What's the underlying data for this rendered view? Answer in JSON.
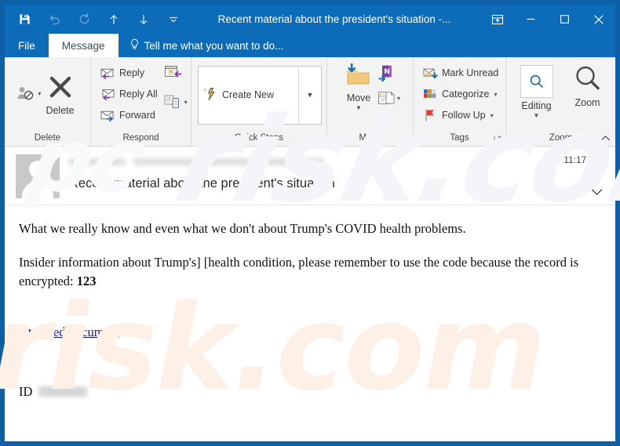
{
  "window": {
    "title": "Recent material about the president's situation -...",
    "accent_color": "#0d6cb9",
    "frame_border_color": "#0f5fa6"
  },
  "quick_access_toolbar": {
    "items": [
      {
        "name": "save-icon",
        "label": "Save",
        "enabled": true
      },
      {
        "name": "undo-icon",
        "label": "Undo",
        "enabled": false
      },
      {
        "name": "redo-icon",
        "label": "Redo",
        "enabled": false
      },
      {
        "name": "previous-item-icon",
        "label": "Previous Item",
        "enabled": true
      },
      {
        "name": "next-item-icon",
        "label": "Next Item",
        "enabled": true
      },
      {
        "name": "customize-qat-icon",
        "label": "Customize Quick Access Toolbar",
        "enabled": true
      }
    ]
  },
  "window_controls": [
    {
      "name": "ribbon-display-options-icon",
      "label": "Ribbon Display Options"
    },
    {
      "name": "minimize-icon",
      "label": "Minimize"
    },
    {
      "name": "maximize-icon",
      "label": "Maximize"
    },
    {
      "name": "close-icon",
      "label": "Close"
    }
  ],
  "tabs": [
    {
      "label": "File",
      "active": false
    },
    {
      "label": "Message",
      "active": true
    }
  ],
  "tell_me": {
    "label": "Tell me what you want to do...",
    "icon": "lightbulb-icon"
  },
  "ribbon": {
    "collapse_label": "^",
    "groups": [
      {
        "name": "delete",
        "label": "Delete",
        "buttons": [
          {
            "label": "Junk",
            "icon": "junk-icon",
            "type": "icon-only-dropdown"
          },
          {
            "label": "Delete",
            "icon": "delete-x-icon",
            "type": "big"
          }
        ]
      },
      {
        "name": "respond",
        "label": "Respond",
        "buttons": [
          {
            "label": "Reply",
            "icon": "reply-icon",
            "type": "small"
          },
          {
            "label": "Reply All",
            "icon": "reply-all-icon",
            "type": "small"
          },
          {
            "label": "Forward",
            "icon": "forward-icon",
            "type": "small"
          },
          {
            "label": "Meeting",
            "icon": "meeting-icon",
            "type": "icon-only"
          },
          {
            "label": "More",
            "icon": "more-respond-icon",
            "type": "icon-only-dropdown"
          }
        ]
      },
      {
        "name": "quick-steps",
        "label": "Quick Steps",
        "has_dialog_launcher": true,
        "gallery": [
          {
            "label": "Create New",
            "icon": "quick-step-new-icon"
          }
        ],
        "more_label": "More Quick Steps"
      },
      {
        "name": "move",
        "label": "Move",
        "has_dialog_launcher": true,
        "buttons": [
          {
            "label": "Move",
            "icon": "move-folder-icon",
            "type": "big-dropdown"
          },
          {
            "label": "OneNote",
            "icon": "onenote-icon",
            "type": "icon-only"
          },
          {
            "label": "Rules",
            "icon": "rules-icon",
            "type": "icon-only-dropdown"
          }
        ]
      },
      {
        "name": "tags",
        "label": "Tags",
        "has_dialog_launcher": true,
        "buttons": [
          {
            "label": "Mark Unread",
            "icon": "mark-unread-icon",
            "type": "small"
          },
          {
            "label": "Categorize",
            "icon": "categorize-icon",
            "type": "small-dropdown"
          },
          {
            "label": "Follow Up",
            "icon": "follow-up-flag-icon",
            "type": "small-dropdown"
          }
        ]
      },
      {
        "name": "zoom",
        "label": "Zoom",
        "buttons": [
          {
            "label": "Editing",
            "icon": "editing-icon",
            "type": "big-dropdown"
          },
          {
            "label": "Zoom",
            "icon": "zoom-magnifier-icon",
            "type": "big"
          }
        ]
      }
    ]
  },
  "message": {
    "avatar": "contact-avatar",
    "sender_redacted": true,
    "timestamp": "11:17 AM",
    "subject": "Recent material about the president's situation",
    "expand_icon": "chevron-down-icon",
    "body": {
      "paragraph1": "What we really know and even what we don't about Trump's COVID health problems.",
      "paragraph2_prefix": "Insider information about Trump's] [health condition, please remember to use the code because the record is encrypted: ",
      "code": "123",
      "attachment_link": "Attached document",
      "id_label": "ID",
      "id_redacted": true
    }
  },
  "watermark": {
    "text_large": "risk.com",
    "text_mid": "pc",
    "color": "#fdf0e7"
  }
}
